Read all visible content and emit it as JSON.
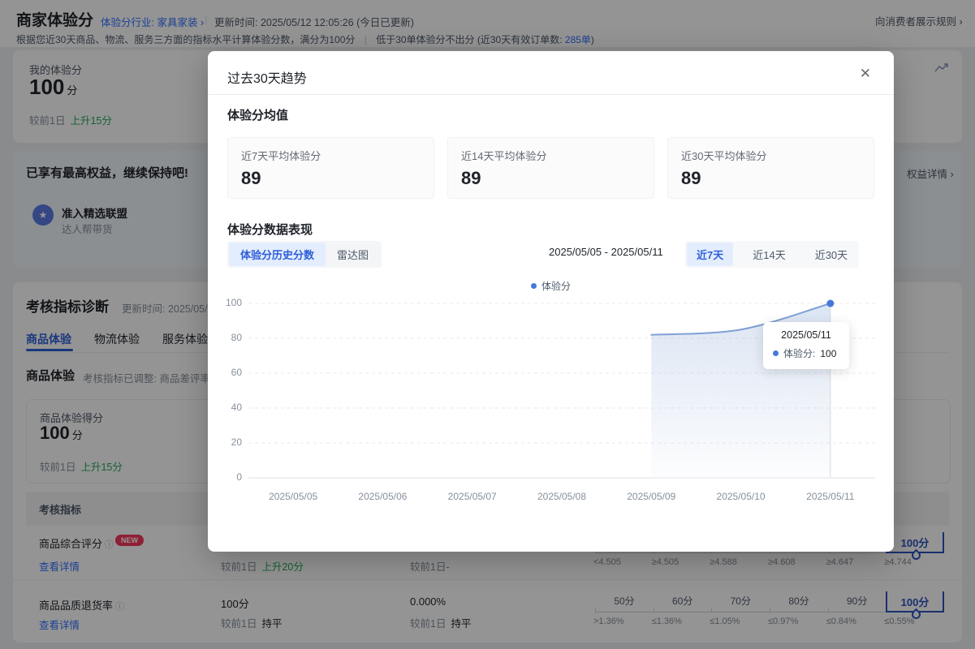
{
  "colors": {
    "accent_blue": "#3370ff",
    "scale_blue": "#2e54c0",
    "green": "#23a757",
    "badge_red": "#f5365c",
    "line_blue": "#7fa0d4",
    "point_blue": "#4678d9",
    "overlay": "rgba(0,0,0,0.42)"
  },
  "page": {
    "topbar": {
      "title": "商家体验分",
      "industry": "体验分行业: 家具家装 ›",
      "sep": "|",
      "update_time": "更新时间: 2025/05/12 12:05:26 (今日已更新)",
      "rules_link": "向消费者展示规则 ›",
      "subtitle_main": "根据您近30天商品、物流、服务三方面的指标水平计算体验分数，满分为100分",
      "subtitle_sep": "|",
      "subtitle_note": "低于30单体验分不出分 (近30天有效订单数: ",
      "order_count": "285单",
      "subtitle_close": ")"
    },
    "my_score": {
      "label": "我的体验分",
      "value": "100",
      "unit": "分",
      "delta_prefix": "较前1日",
      "delta": "上升15分"
    },
    "benefit": {
      "title": "已享有最高权益，继续保持吧!",
      "perk_title": "准入精选联盟",
      "perk_sub": "达人帮带货",
      "details_link": "权益详情 ›"
    },
    "diagnosis": {
      "title": "考核指标诊断",
      "update_time": "更新时间: 2025/05/",
      "tabs": [
        {
          "label": "商品体验"
        },
        {
          "label": "物流体验"
        },
        {
          "label": "服务体验"
        }
      ],
      "section_title": "商品体验",
      "section_note": "考核指标已调整: 商品差评率不",
      "score_label": "商品体验得分",
      "score_value": "100",
      "score_unit": "分",
      "score_delta_prefix": "较前1日",
      "score_delta": "上升15分",
      "table_header": "考核指标",
      "rows": [
        {
          "name": "商品综合评分",
          "info_icon": "ⓘ",
          "badge": "NEW",
          "link": "查看详情",
          "col2_prefix": "较前1日",
          "col2_delta": "上升20分",
          "col3_text": "较前1日-",
          "scale_top": [
            "",
            "",
            "",
            "",
            "",
            "100分"
          ],
          "scale_bottom": [
            "<4.505",
            "≥4.505",
            "≥4.588",
            "≥4.608",
            "≥4.647",
            "≥4.744"
          ]
        },
        {
          "name": "商品品质退货率",
          "info_icon": "ⓘ",
          "badge": "",
          "link": "查看详情",
          "col2_value": "100分",
          "col2_prefix": "较前1日",
          "col2_delta": "持平",
          "col3_value": "0.000%",
          "col3_prefix": "较前1日",
          "col3_delta": "持平",
          "scale_top": [
            "50分",
            "60分",
            "70分",
            "80分",
            "90分",
            "100分"
          ],
          "scale_bottom": [
            ">1.36%",
            "≤1.36%",
            "≤1.05%",
            "≤0.97%",
            "≤0.84%",
            "≤0.55%"
          ]
        }
      ]
    }
  },
  "modal": {
    "title": "过去30天趋势",
    "close_icon": "✕",
    "avg_title": "体验分均值",
    "avg_cards": [
      {
        "label": "近7天平均体验分",
        "value": "89"
      },
      {
        "label": "近14天平均体验分",
        "value": "89"
      },
      {
        "label": "近30天平均体验分",
        "value": "89"
      }
    ],
    "perf_title": "体验分数据表现",
    "view_toggles": [
      {
        "label": "体验分历史分数",
        "active": true
      },
      {
        "label": "雷达图",
        "active": false
      }
    ],
    "date_range": "2025/05/05 - 2025/05/11",
    "range_tabs": [
      {
        "label": "近7天",
        "active": true
      },
      {
        "label": "近14天",
        "active": false
      },
      {
        "label": "近30天",
        "active": false
      }
    ],
    "legend": "体验分",
    "tooltip": {
      "date": "2025/05/11",
      "series": "体验分: ",
      "value": "100"
    }
  },
  "chart_data": {
    "type": "line",
    "title": "体验分历史分数 (近7天)",
    "x": [
      "2025/05/05",
      "2025/05/06",
      "2025/05/07",
      "2025/05/08",
      "2025/05/09",
      "2025/05/10",
      "2025/05/11"
    ],
    "series": [
      {
        "name": "体验分",
        "values": [
          null,
          null,
          null,
          null,
          82,
          85,
          100
        ]
      }
    ],
    "ylim": [
      0,
      100
    ],
    "yticks": [
      0,
      20,
      40,
      60,
      80,
      100
    ],
    "grid": "horizontal-dashed",
    "legend_position": "top-center",
    "line_color": "#7fa0d4",
    "point_color": "#4678d9",
    "area_fill": "light-blue-gradient",
    "highlighted_point": {
      "x": "2025/05/11",
      "value": 100
    }
  }
}
